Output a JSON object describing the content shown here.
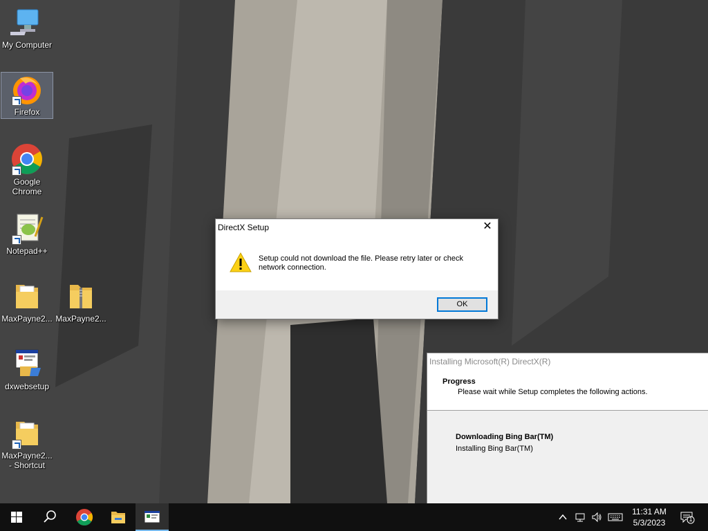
{
  "desktop": {
    "icons": [
      {
        "label": "My Computer",
        "icon": "computer-icon"
      },
      {
        "label": "Firefox",
        "icon": "firefox-icon"
      },
      {
        "label": "Google Chrome",
        "icon": "chrome-icon"
      },
      {
        "label": "Notepad++",
        "icon": "notepadpp-icon"
      },
      {
        "label": "MaxPayne2...",
        "icon": "folder-icon"
      },
      {
        "label": "MaxPayne2...",
        "icon": "zip-folder-icon"
      },
      {
        "label": "dxwebsetup",
        "icon": "setup-icon"
      },
      {
        "label": "MaxPayne2... - Shortcut",
        "icon": "folder-shortcut-icon"
      }
    ]
  },
  "dialog": {
    "title": "DirectX Setup",
    "close": "✕",
    "message": "Setup could not download the file. Please retry later or check network connection.",
    "ok_label": "OK"
  },
  "installer": {
    "title": "Installing Microsoft(R) DirectX(R)",
    "heading": "Progress",
    "subheading": "Please wait while Setup completes the following actions.",
    "action": "Downloading Bing Bar(TM)",
    "action_detail": "Installing Bing Bar(TM)"
  },
  "taskbar": {
    "clock_time": "11:31 AM",
    "clock_date": "5/3/2023",
    "notification_count": "1"
  },
  "colors": {
    "taskbar": "#101010",
    "accent": "#0078d7",
    "active_indicator": "#76b9ed"
  }
}
